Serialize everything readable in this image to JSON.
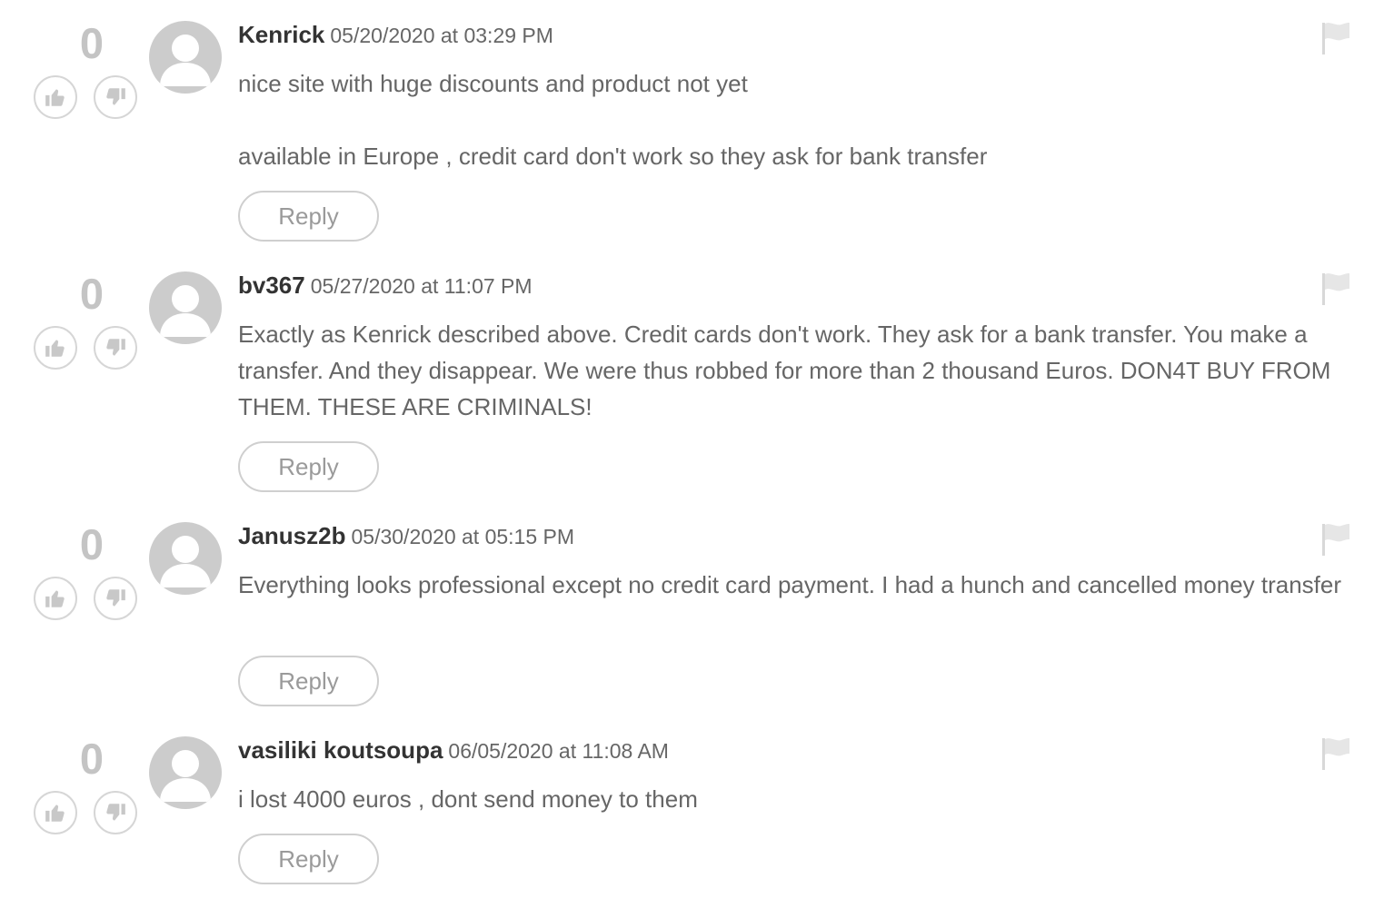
{
  "colors": {
    "score": "#c4c4c4",
    "author": "#333333",
    "text": "#666666",
    "reply_text": "#9a9a9a",
    "border": "#d6d6d6",
    "avatar_bg": "#cccccc"
  },
  "comments": [
    {
      "score": "0",
      "author": "Kenrick",
      "timestamp": "05/20/2020 at 03:29 PM",
      "paragraphs": [
        "nice site with huge discounts and product not yet",
        "available in Europe , credit card don't work so they ask for bank transfer"
      ],
      "reply_label": "Reply"
    },
    {
      "score": "0",
      "author": "bv367",
      "timestamp": "05/27/2020 at 11:07 PM",
      "paragraphs": [
        "Exactly as Kenrick described above. Credit cards don't work. They ask for a bank transfer. You make a transfer. And they disappear. We were thus robbed for more than 2 thousand Euros. DON4T BUY FROM THEM. THESE ARE CRIMINALS!"
      ],
      "reply_label": "Reply"
    },
    {
      "score": "0",
      "author": "Janusz2b",
      "timestamp": "05/30/2020 at 05:15 PM",
      "paragraphs": [
        "Everything looks professional except no credit card payment. I had a hunch and cancelled money transfer"
      ],
      "reply_label": "Reply"
    },
    {
      "score": "0",
      "author": "vasiliki koutsoupa",
      "timestamp": "06/05/2020 at 11:08 AM",
      "paragraphs": [
        "i lost 4000 euros , dont send money to them"
      ],
      "reply_label": "Reply"
    }
  ],
  "icons": {
    "upvote": "thumbs-up-icon",
    "downvote": "thumbs-down-icon",
    "avatar": "default-user-avatar",
    "flag": "flag-icon"
  }
}
